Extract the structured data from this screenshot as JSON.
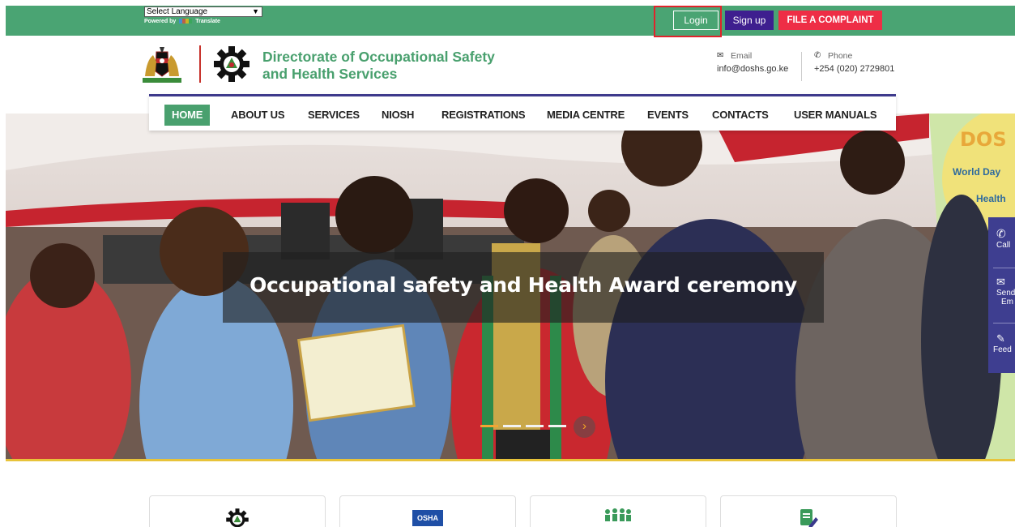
{
  "topbar": {
    "language_select": "Select Language",
    "powered_by": "Powered by",
    "translate": "Translate",
    "login": "Login",
    "signup": "Sign up",
    "complaint": "FILE A COMPLAINT"
  },
  "header": {
    "org_line1": "Directorate of Occupational Safety",
    "org_line2": "and Health Services",
    "email_label": "Email",
    "email_value": "info@doshs.go.ke",
    "phone_label": "Phone",
    "phone_value": "+254 (020) 2729801"
  },
  "nav": {
    "items": [
      {
        "label": "HOME"
      },
      {
        "label": "ABOUT US"
      },
      {
        "label": "SERVICES"
      },
      {
        "label": "NIOSH"
      },
      {
        "label": "REGISTRATIONS"
      },
      {
        "label": "MEDIA CENTRE"
      },
      {
        "label": "EVENTS"
      },
      {
        "label": "CONTACTS"
      },
      {
        "label": "USER MANUALS"
      }
    ]
  },
  "hero": {
    "caption": "Occupational safety and Health Award ceremony",
    "banner_text": "DOS",
    "banner_sub1": "World Day",
    "banner_sub2": "Health",
    "side_call": "Call",
    "side_send": "Send",
    "side_email": "Em",
    "side_feedback": "Feed"
  },
  "cards": {
    "osha_label": "OSHA"
  },
  "colors": {
    "green": "#4aa473",
    "purple": "#3e1f8f",
    "red": "#ee2e46",
    "accent": "#f1a634"
  }
}
